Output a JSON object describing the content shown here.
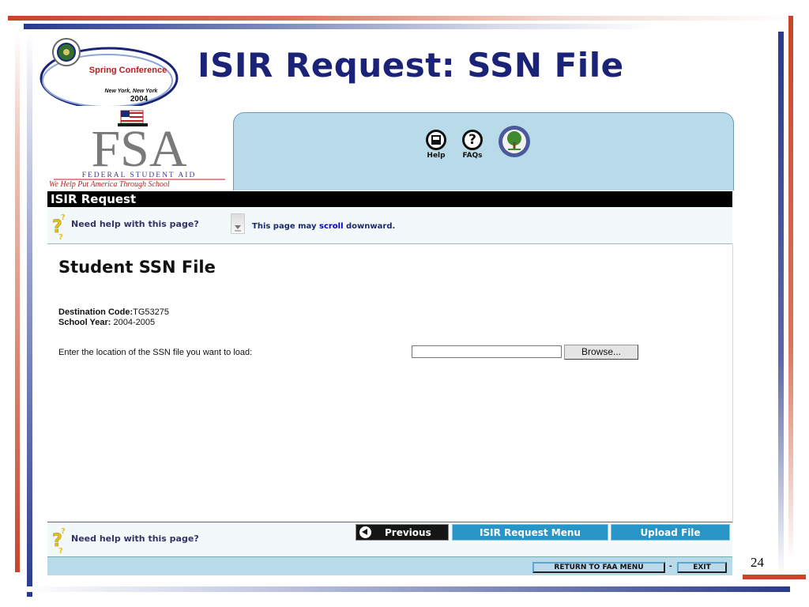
{
  "slide": {
    "title": "ISIR Request: SSN File",
    "page_number": "24",
    "conference_logo": {
      "line1": "Spring Conference",
      "line2": "New York, New York",
      "line3": "2004"
    }
  },
  "browser": {
    "fsa_logo": {
      "letters": "FSA",
      "subtitle": "FEDERAL STUDENT AID",
      "tagline": "We Help Put America Through School"
    },
    "header_icons": [
      {
        "name": "help-icon",
        "label": "Help"
      },
      {
        "name": "faqs-icon",
        "label": "FAQs"
      }
    ],
    "title_bar": "ISIR Request",
    "help_link": "Need help with this page?",
    "scroll_note": {
      "before": "This page may ",
      "keyword": "scroll",
      "after": " downward."
    },
    "page_heading": "Student SSN File",
    "destination_code_label": "Destination Code:",
    "destination_code": "TG53275",
    "school_year_label": "School Year:",
    "school_year": "2004-2005",
    "file_prompt": "Enter the location of the SSN file you want to load:",
    "file_input_value": "",
    "browse_label": "Browse...",
    "footer": {
      "help_link": "Need help with this page?",
      "previous": "Previous",
      "isir_menu": "ISIR Request Menu",
      "upload": "Upload File",
      "return_menu": "RETURN TO FAA MENU",
      "separator": "-",
      "exit": "EXIT"
    },
    "colors": {
      "header_blue": "#b9dbe9",
      "nav_blue": "#2795c8",
      "title_navy": "#1a2378"
    }
  }
}
